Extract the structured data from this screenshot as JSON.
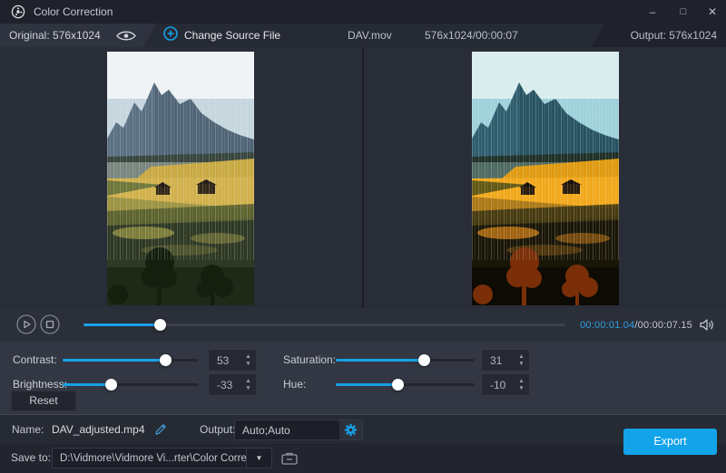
{
  "window": {
    "title": "Color Correction"
  },
  "icons": {
    "minimize": "–",
    "maximize": "□",
    "close": "✕",
    "dropdown": "▼",
    "spinner_up": "▲",
    "spinner_down": "▼"
  },
  "topbar": {
    "original_label": "Original: 576x1024",
    "change_source_label": "Change Source File",
    "filename": "DAV.mov",
    "source_info": "576x1024/00:00:07",
    "output_label": "Output: 576x1024"
  },
  "previews": {
    "original_alt": "original portrait video frame: mountain landscape with meadow, huts and trees",
    "output_alt": "color-corrected portrait video frame: same landscape with boosted contrast and saturation"
  },
  "playback": {
    "current_time": "00:00:01.04",
    "total_time": "/00:00:07.15",
    "progress_pct": 16
  },
  "adjustments": {
    "contrast": {
      "label": "Contrast:",
      "value": "53",
      "pct": 76
    },
    "saturation": {
      "label": "Saturation:",
      "value": "31",
      "pct": 64
    },
    "brightness": {
      "label": "Brightness:",
      "value": "-33",
      "pct": 36
    },
    "hue": {
      "label": "Hue:",
      "value": "-10",
      "pct": 45
    },
    "reset_label": "Reset"
  },
  "output_settings": {
    "name_label": "Name:",
    "name_value": "DAV_adjusted.mp4",
    "output_label": "Output:",
    "output_value": "Auto;Auto"
  },
  "save": {
    "label": "Save to:",
    "path": "D:\\Vidmore\\Vidmore Vi...rter\\Color Correction",
    "export_label": "Export"
  },
  "colors": {
    "accent": "#12a3e9",
    "time_accent": "#2f9fe2"
  }
}
